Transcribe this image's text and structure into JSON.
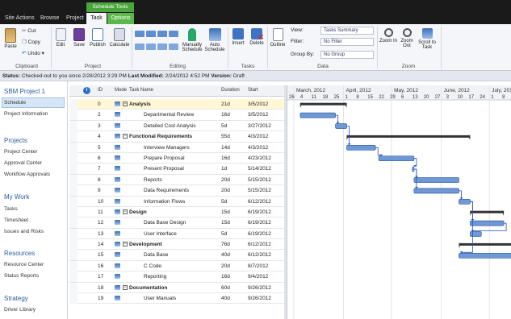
{
  "context_tab": "Schedule Tools",
  "tabs": {
    "site_actions": "Site Actions ▾",
    "browse": "Browse",
    "project": "Project",
    "task": "Task",
    "options": "Options"
  },
  "ribbon": {
    "clipboard": {
      "paste": "Paste",
      "cut": "Cut",
      "copy": "Copy",
      "undo": "Undo ▾",
      "label": "Clipboard"
    },
    "project": {
      "edit": "Edit",
      "save": "Save",
      "publish": "Publish",
      "calculate": "Calculate",
      "label": "Project"
    },
    "editing": {
      "manually": "Manually Schedule",
      "auto": "Auto Schedule",
      "label": "Editing"
    },
    "tasks": {
      "insert": "Insert",
      "delete": "Delete",
      "label": "Tasks"
    },
    "data": {
      "outline": "Outline",
      "view_label": "View:",
      "view_value": "Tasks Summary",
      "filter_label": "Filter:",
      "filter_value": "No Filter",
      "group_label": "Group By:",
      "group_value": "No Group",
      "label": "Data"
    },
    "zoom": {
      "zoom_in": "Zoom In",
      "zoom_out": "Zoom Out",
      "scroll": "Scroll to Task",
      "label": "Zoom"
    }
  },
  "status": {
    "label1": "Status:",
    "text1": "Checked-out to you since 2/28/2012 3:29 PM",
    "label2": "Last Modified:",
    "text2": "2/24/2012 4:52 PM",
    "label3": "Version:",
    "text3": "Draft"
  },
  "nav": {
    "project_title": "SBM Project 1",
    "project_items": [
      "Schedule",
      "Project Information"
    ],
    "projects_head": "Projects",
    "projects_items": [
      "Project Center",
      "Approval Center",
      "Workflow Approvals"
    ],
    "mywork_head": "My Work",
    "mywork_items": [
      "Tasks",
      "Timesheet",
      "Issues and Risks"
    ],
    "resources_head": "Resources",
    "resources_items": [
      "Resource Center",
      "Status Reports"
    ],
    "strategy_head": "Strategy",
    "strategy_items": [
      "Driver Library"
    ]
  },
  "grid": {
    "headers": {
      "info": "i",
      "id": "ID",
      "mode": "Mode",
      "name": "Task Name",
      "duration": "Duration",
      "start": "Start"
    },
    "rows": [
      {
        "id": "0",
        "name": "Analysis",
        "duration": "21d",
        "start": "3/5/2012",
        "summary": true
      },
      {
        "id": "2",
        "name": "Departmental Review",
        "duration": "16d",
        "start": "3/5/2012",
        "summary": false
      },
      {
        "id": "3",
        "name": "Detailed Cost Analysis",
        "duration": "5d",
        "start": "3/27/2012",
        "summary": false
      },
      {
        "id": "4",
        "name": "Functional Requirements",
        "duration": "55d",
        "start": "4/3/2012",
        "summary": true
      },
      {
        "id": "5",
        "name": "Interview Managers",
        "duration": "14d",
        "start": "4/3/2012",
        "summary": false
      },
      {
        "id": "6",
        "name": "Prepare Proposal",
        "duration": "16d",
        "start": "4/23/2012",
        "summary": false
      },
      {
        "id": "7",
        "name": "Present Proposal",
        "duration": "1d",
        "start": "5/14/2012",
        "summary": false
      },
      {
        "id": "8",
        "name": "Reports",
        "duration": "20d",
        "start": "5/15/2012",
        "summary": false
      },
      {
        "id": "9",
        "name": "Data Requirements",
        "duration": "20d",
        "start": "5/15/2012",
        "summary": false
      },
      {
        "id": "10",
        "name": "Information Flows",
        "duration": "5d",
        "start": "6/12/2012",
        "summary": false
      },
      {
        "id": "11",
        "name": "Design",
        "duration": "15d",
        "start": "6/19/2012",
        "summary": true
      },
      {
        "id": "12",
        "name": "Data Base Design",
        "duration": "15d",
        "start": "6/19/2012",
        "summary": false
      },
      {
        "id": "13",
        "name": "User Interface",
        "duration": "5d",
        "start": "6/19/2012",
        "summary": false
      },
      {
        "id": "14",
        "name": "Development",
        "duration": "76d",
        "start": "6/12/2012",
        "summary": true
      },
      {
        "id": "15",
        "name": "Data Base",
        "duration": "40d",
        "start": "6/12/2012",
        "summary": false
      },
      {
        "id": "16",
        "name": "C Code",
        "duration": "20d",
        "start": "8/7/2012",
        "summary": false
      },
      {
        "id": "17",
        "name": "Reporting",
        "duration": "16d",
        "start": "9/4/2012",
        "summary": false
      },
      {
        "id": "18",
        "name": "Documentation",
        "duration": "60d",
        "start": "9/26/2012",
        "summary": true
      },
      {
        "id": "19",
        "name": "User Manuals",
        "duration": "40d",
        "start": "9/26/2012",
        "summary": false
      }
    ]
  },
  "timeline": {
    "months": [
      "March, 2012",
      "April, 2012",
      "May, 2012",
      "June, 2012",
      "July, 2012"
    ],
    "days": [
      "26",
      "4",
      "11",
      "18",
      "25",
      "1",
      "8",
      "15",
      "22",
      "29",
      "6",
      "13",
      "20",
      "27",
      "3",
      "10",
      "17",
      "24",
      "1",
      "8",
      "15"
    ]
  }
}
